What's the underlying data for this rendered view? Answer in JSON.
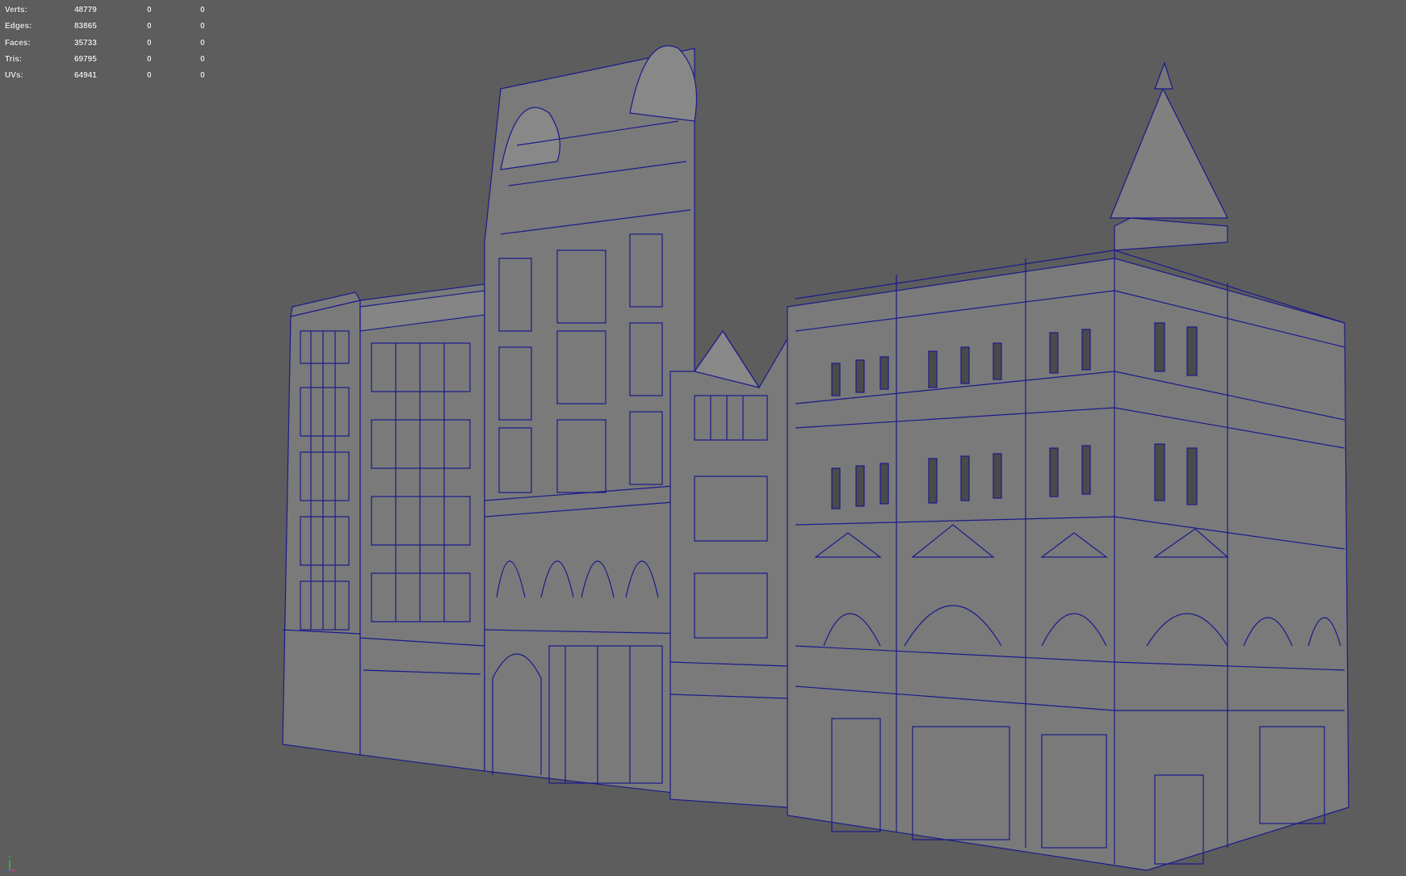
{
  "heads_up_display": {
    "rows": [
      {
        "label": "Verts:",
        "total": "48779",
        "selected": "0",
        "component": "0"
      },
      {
        "label": "Edges:",
        "total": "83865",
        "selected": "0",
        "component": "0"
      },
      {
        "label": "Faces:",
        "total": "35733",
        "selected": "0",
        "component": "0"
      },
      {
        "label": "Tris:",
        "total": "69795",
        "selected": "0",
        "component": "0"
      },
      {
        "label": "UVs:",
        "total": "64941",
        "selected": "0",
        "component": "0"
      }
    ]
  },
  "view_axis": {
    "y_label": "Y",
    "z_label": "Z"
  },
  "colors": {
    "background": "#5d5d5d",
    "wireframe": "#1a1a8c",
    "mesh_fill": "#7a7a7a",
    "hud_text": "#ececec"
  }
}
